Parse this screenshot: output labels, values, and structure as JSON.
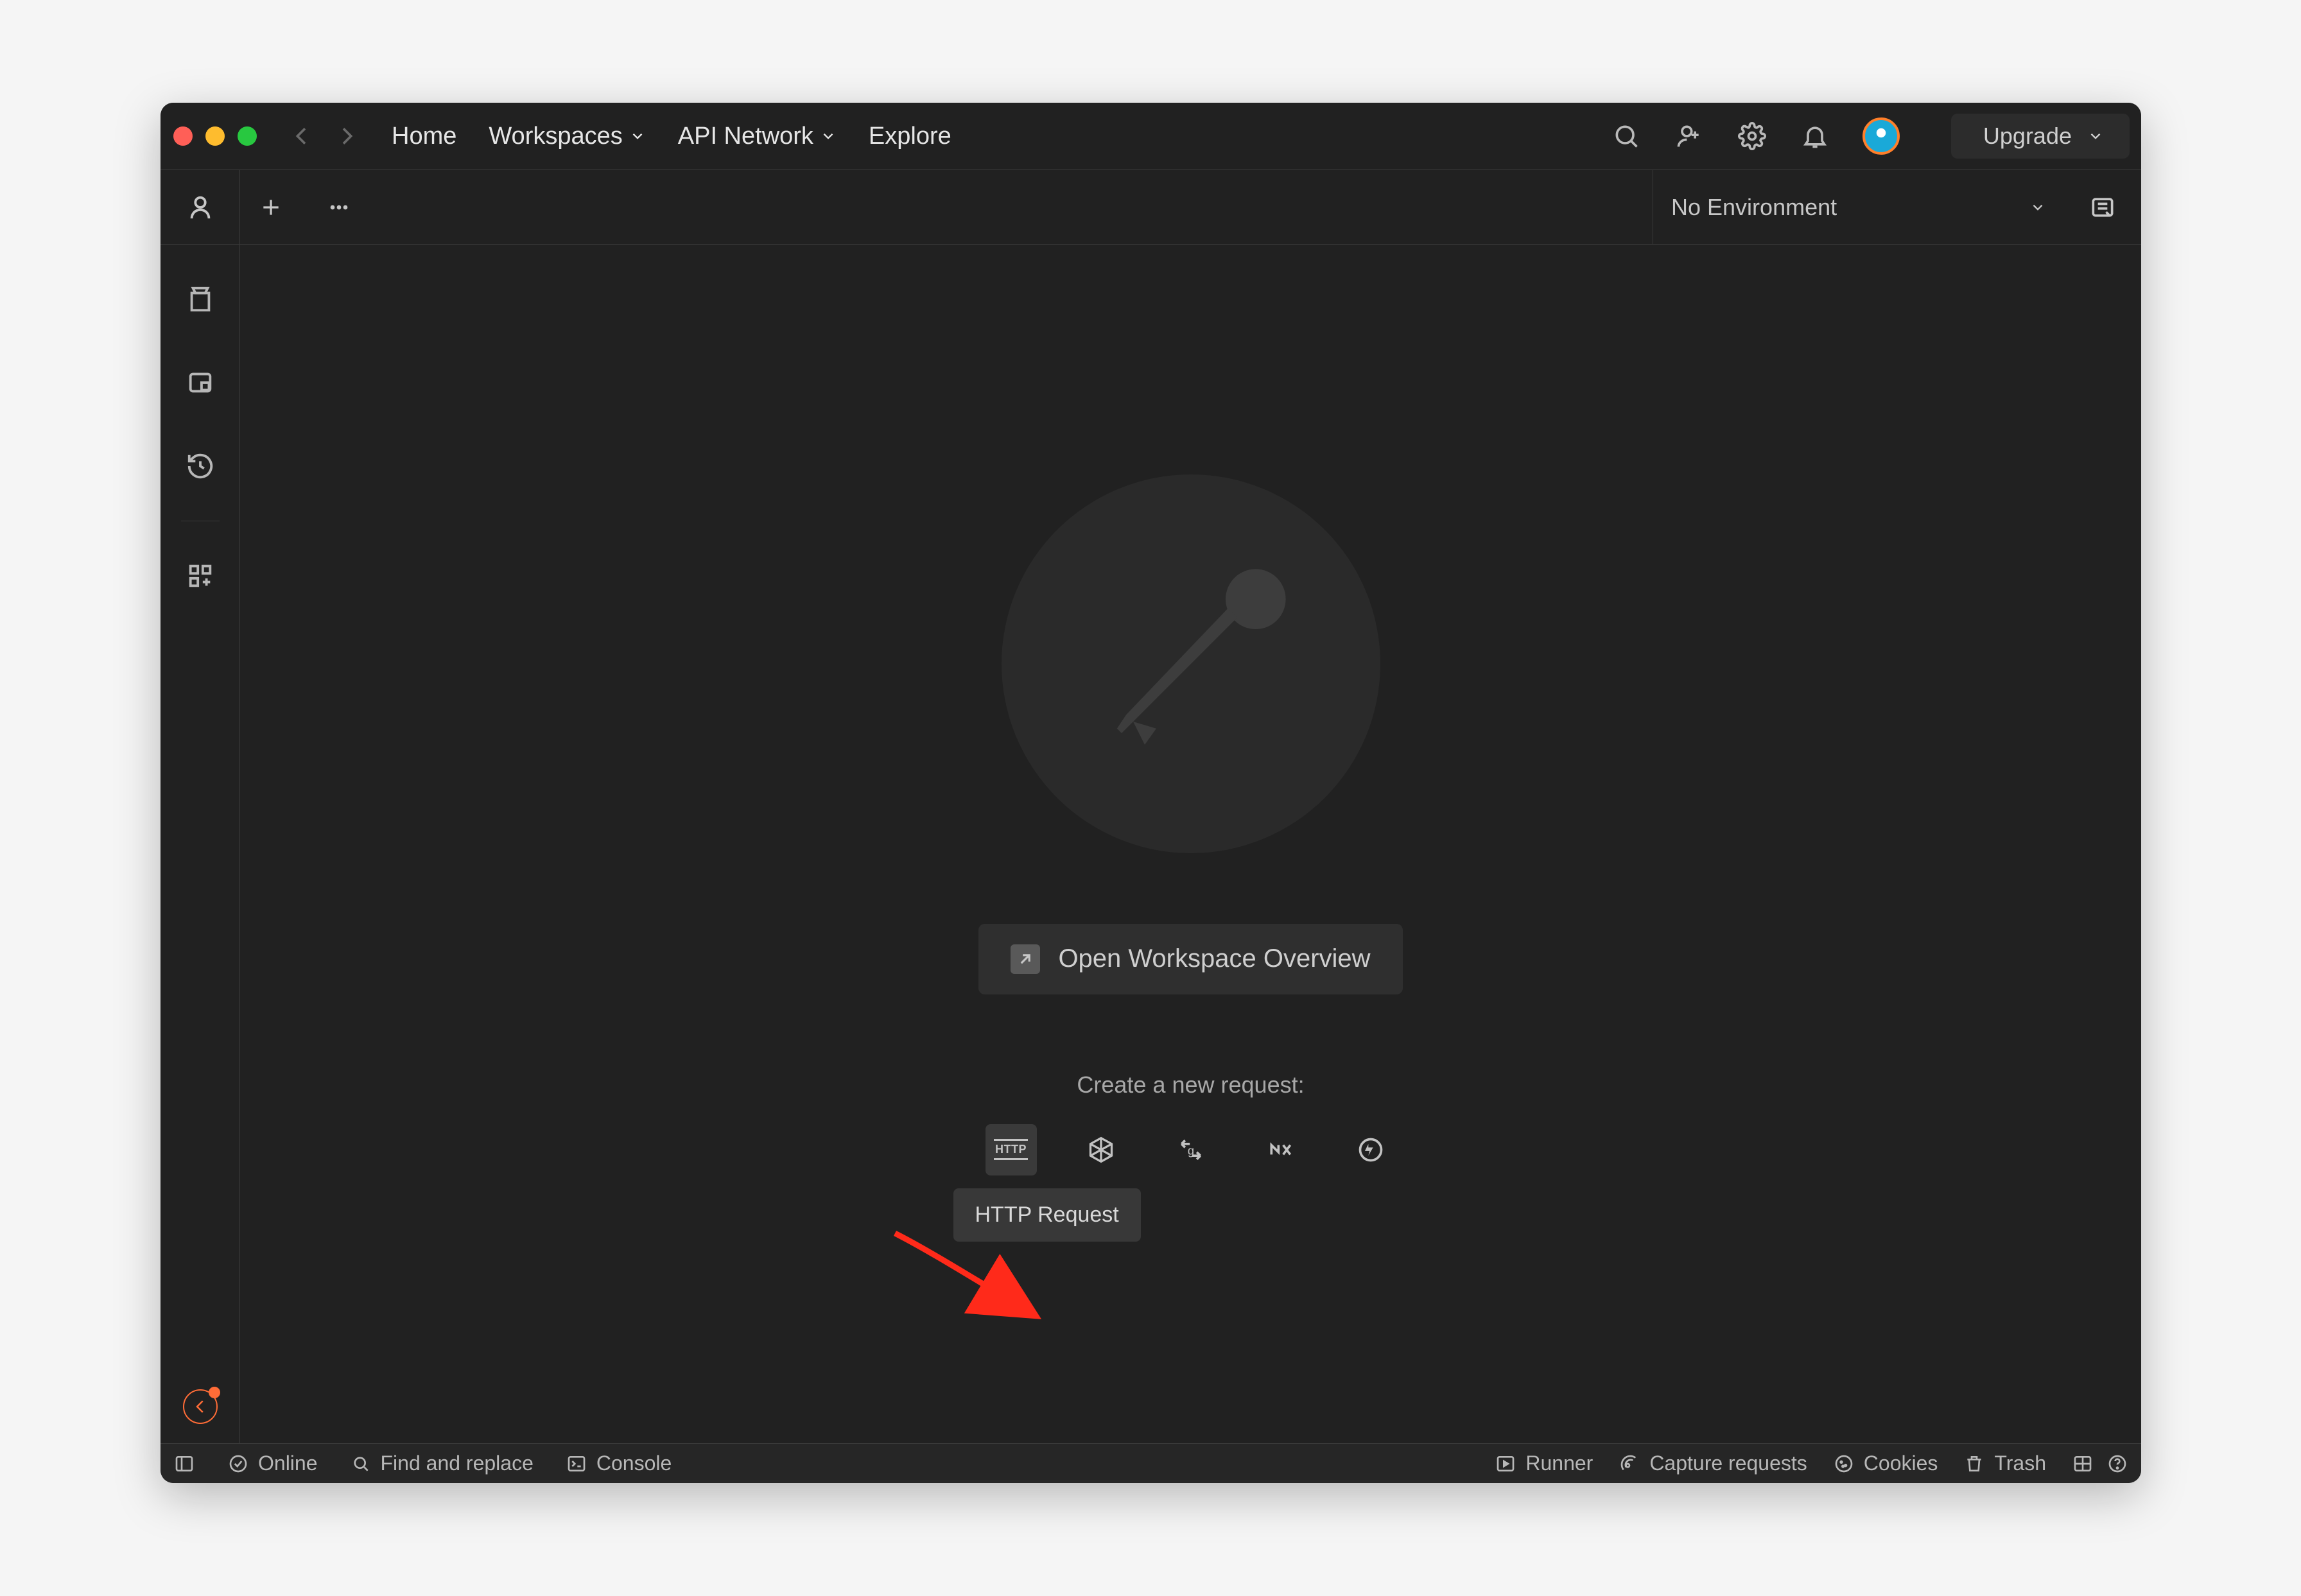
{
  "titlebar": {
    "nav_home": "Home",
    "nav_workspaces": "Workspaces",
    "nav_api_network": "API Network",
    "nav_explore": "Explore",
    "upgrade_label": "Upgrade"
  },
  "subbar": {
    "environment_label": "No Environment"
  },
  "main": {
    "open_overview_label": "Open Workspace Overview",
    "create_request_label": "Create a new request:",
    "tooltip_http": "HTTP Request"
  },
  "statusbar": {
    "online": "Online",
    "find_replace": "Find and replace",
    "console": "Console",
    "runner": "Runner",
    "capture_requests": "Capture requests",
    "cookies": "Cookies",
    "trash": "Trash"
  }
}
